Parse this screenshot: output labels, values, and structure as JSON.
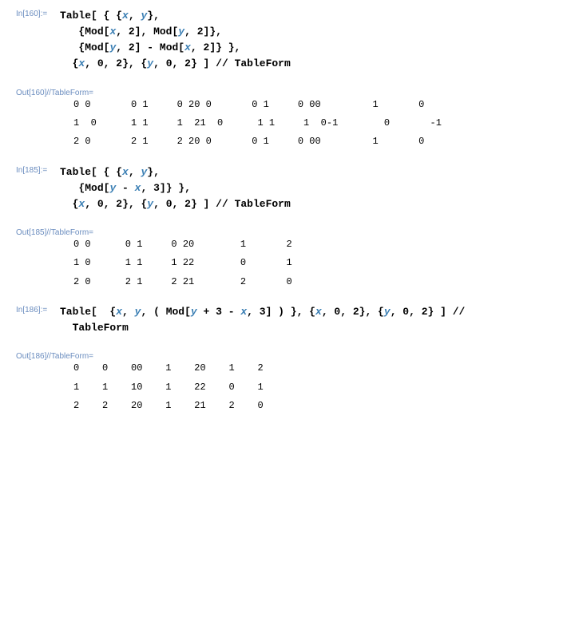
{
  "cells": [
    {
      "inLabel": "In[160]:=",
      "inputLines": [
        [
          {
            "t": "fn",
            "v": "Table"
          },
          {
            "t": "p",
            "v": "[ { {"
          },
          {
            "t": "var",
            "v": "x"
          },
          {
            "t": "p",
            "v": ", "
          },
          {
            "t": "var",
            "v": "y"
          },
          {
            "t": "p",
            "v": "},"
          }
        ],
        [
          {
            "t": "pad",
            "v": "   "
          },
          {
            "t": "p",
            "v": "{"
          },
          {
            "t": "fn",
            "v": "Mod"
          },
          {
            "t": "p",
            "v": "["
          },
          {
            "t": "var",
            "v": "x"
          },
          {
            "t": "p",
            "v": ", "
          },
          {
            "t": "num",
            "v": "2"
          },
          {
            "t": "p",
            "v": "], "
          },
          {
            "t": "fn",
            "v": "Mod"
          },
          {
            "t": "p",
            "v": "["
          },
          {
            "t": "var",
            "v": "y"
          },
          {
            "t": "p",
            "v": ", "
          },
          {
            "t": "num",
            "v": "2"
          },
          {
            "t": "p",
            "v": "]},"
          }
        ],
        [
          {
            "t": "pad",
            "v": "   "
          },
          {
            "t": "p",
            "v": "{"
          },
          {
            "t": "fn",
            "v": "Mod"
          },
          {
            "t": "p",
            "v": "["
          },
          {
            "t": "var",
            "v": "y"
          },
          {
            "t": "p",
            "v": ", "
          },
          {
            "t": "num",
            "v": "2"
          },
          {
            "t": "p",
            "v": "] - "
          },
          {
            "t": "fn",
            "v": "Mod"
          },
          {
            "t": "p",
            "v": "["
          },
          {
            "t": "var",
            "v": "x"
          },
          {
            "t": "p",
            "v": ", "
          },
          {
            "t": "num",
            "v": "2"
          },
          {
            "t": "p",
            "v": "]} },"
          }
        ],
        [
          {
            "t": "pad",
            "v": "  "
          },
          {
            "t": "p",
            "v": "{"
          },
          {
            "t": "var",
            "v": "x"
          },
          {
            "t": "p",
            "v": ", "
          },
          {
            "t": "num",
            "v": "0"
          },
          {
            "t": "p",
            "v": ", "
          },
          {
            "t": "num",
            "v": "2"
          },
          {
            "t": "p",
            "v": "}, {"
          },
          {
            "t": "var",
            "v": "y"
          },
          {
            "t": "p",
            "v": ", "
          },
          {
            "t": "num",
            "v": "0"
          },
          {
            "t": "p",
            "v": ", "
          },
          {
            "t": "num",
            "v": "2"
          },
          {
            "t": "p",
            "v": "} ] // "
          },
          {
            "t": "fn",
            "v": "TableForm"
          }
        ]
      ],
      "outLabel": "Out[160]//TableForm=",
      "outputGroups": [
        [
          "0 0       0 1     0 2",
          "0 0       0 1     0 0",
          "0         1       0"
        ],
        [
          "1  0      1 1     1  2",
          "1  0      1 1     1  0",
          "-1        0       -1"
        ],
        [
          "2 0       2 1     2 2",
          "0 0       0 1     0 0",
          "0         1       0"
        ]
      ]
    },
    {
      "inLabel": "In[185]:=",
      "inputLines": [
        [
          {
            "t": "fn",
            "v": "Table"
          },
          {
            "t": "p",
            "v": "[ { {"
          },
          {
            "t": "var",
            "v": "x"
          },
          {
            "t": "p",
            "v": ", "
          },
          {
            "t": "var",
            "v": "y"
          },
          {
            "t": "p",
            "v": "},"
          }
        ],
        [
          {
            "t": "pad",
            "v": "   "
          },
          {
            "t": "p",
            "v": "{"
          },
          {
            "t": "fn",
            "v": "Mod"
          },
          {
            "t": "p",
            "v": "["
          },
          {
            "t": "var",
            "v": "y"
          },
          {
            "t": "p",
            "v": " - "
          },
          {
            "t": "var",
            "v": "x"
          },
          {
            "t": "p",
            "v": ", "
          },
          {
            "t": "num",
            "v": "3"
          },
          {
            "t": "p",
            "v": "]} },"
          }
        ],
        [
          {
            "t": "pad",
            "v": "  "
          },
          {
            "t": "p",
            "v": "{"
          },
          {
            "t": "var",
            "v": "x"
          },
          {
            "t": "p",
            "v": ", "
          },
          {
            "t": "num",
            "v": "0"
          },
          {
            "t": "p",
            "v": ", "
          },
          {
            "t": "num",
            "v": "2"
          },
          {
            "t": "p",
            "v": "}, {"
          },
          {
            "t": "var",
            "v": "y"
          },
          {
            "t": "p",
            "v": ", "
          },
          {
            "t": "num",
            "v": "0"
          },
          {
            "t": "p",
            "v": ", "
          },
          {
            "t": "num",
            "v": "2"
          },
          {
            "t": "p",
            "v": "} ] // "
          },
          {
            "t": "fn",
            "v": "TableForm"
          }
        ]
      ],
      "outLabel": "Out[185]//TableForm=",
      "outputGroups": [
        [
          "0 0      0 1     0 2",
          "0        1       2"
        ],
        [
          "1 0      1 1     1 2",
          "2        0       1"
        ],
        [
          "2 0      2 1     2 2",
          "1        2       0"
        ]
      ]
    },
    {
      "inLabel": "In[186]:=",
      "inputLines": [
        [
          {
            "t": "fn",
            "v": "Table"
          },
          {
            "t": "p",
            "v": "[  {"
          },
          {
            "t": "var",
            "v": "x"
          },
          {
            "t": "p",
            "v": ", "
          },
          {
            "t": "var",
            "v": "y"
          },
          {
            "t": "p",
            "v": ", ( "
          },
          {
            "t": "fn",
            "v": "Mod"
          },
          {
            "t": "p",
            "v": "["
          },
          {
            "t": "var",
            "v": "y"
          },
          {
            "t": "p",
            "v": " + "
          },
          {
            "t": "num",
            "v": "3"
          },
          {
            "t": "p",
            "v": " - "
          },
          {
            "t": "var",
            "v": "x"
          },
          {
            "t": "p",
            "v": ", "
          },
          {
            "t": "num",
            "v": "3"
          },
          {
            "t": "p",
            "v": "] ) }, {"
          },
          {
            "t": "var",
            "v": "x"
          },
          {
            "t": "p",
            "v": ", "
          },
          {
            "t": "num",
            "v": "0"
          },
          {
            "t": "p",
            "v": ", "
          },
          {
            "t": "num",
            "v": "2"
          },
          {
            "t": "p",
            "v": "}, {"
          },
          {
            "t": "var",
            "v": "y"
          },
          {
            "t": "p",
            "v": ", "
          },
          {
            "t": "num",
            "v": "0"
          },
          {
            "t": "p",
            "v": ", "
          },
          {
            "t": "num",
            "v": "2"
          },
          {
            "t": "p",
            "v": "} ] //"
          }
        ],
        [
          {
            "t": "pad",
            "v": "  "
          },
          {
            "t": "fn",
            "v": "TableForm"
          }
        ]
      ],
      "outLabel": "Out[186]//TableForm=",
      "outputGroups": [
        [
          "0    0    0",
          "0    1    2",
          "0    1    2"
        ],
        [
          "1    1    1",
          "0    1    2",
          "2    0    1"
        ],
        [
          "2    2    2",
          "0    1    2",
          "1    2    0"
        ]
      ]
    }
  ]
}
